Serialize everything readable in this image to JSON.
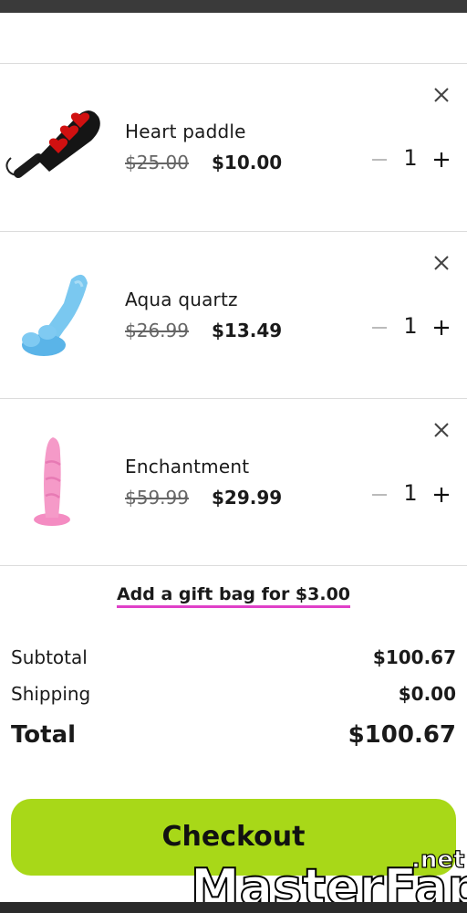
{
  "cart": {
    "items": [
      {
        "name": "Heart paddle",
        "old_price": "$25.00",
        "new_price": "$10.00",
        "quantity": "1",
        "image": "heart-paddle-image"
      },
      {
        "name": "Aqua quartz",
        "old_price": "$26.99",
        "new_price": "$13.49",
        "quantity": "1",
        "image": "aqua-quartz-image"
      },
      {
        "name": "Enchantment",
        "old_price": "$59.99",
        "new_price": "$29.99",
        "quantity": "1",
        "image": "enchantment-image"
      }
    ],
    "remove_icon": "close-icon",
    "minus_icon": "minus-icon",
    "plus_icon": "plus-icon"
  },
  "gift": {
    "label": "Add a gift bag for $3.00"
  },
  "summary": {
    "subtotal_label": "Subtotal",
    "subtotal_value": "$100.67",
    "shipping_label": "Shipping",
    "shipping_value": "$0.00",
    "total_label": "Total",
    "total_value": "$100.67"
  },
  "checkout": {
    "label": "Checkout"
  },
  "watermark": {
    "text_main": "MasterFap",
    "text_suffix": ".net"
  },
  "colors": {
    "accent_green": "#a8d818",
    "gift_underline": "#e040c8",
    "heart_red": "#d01010",
    "aqua": "#5ab4e8",
    "pink": "#f59ac8"
  }
}
